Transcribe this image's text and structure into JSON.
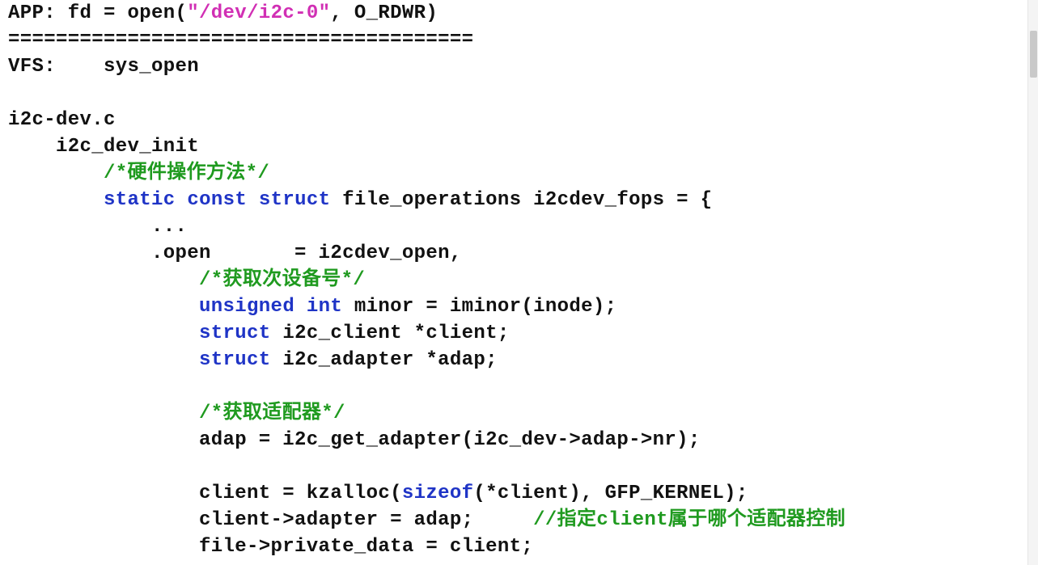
{
  "colors": {
    "keyword": "#1f34c6",
    "string": "#d12fb4",
    "comment": "#1f9a1f",
    "text": "#111111",
    "background": "#ffffff"
  },
  "lines": [
    {
      "tokens": [
        {
          "text": "APP: fd = open(",
          "cls": ""
        },
        {
          "text": "\"/dev/i2c-0\"",
          "cls": "str"
        },
        {
          "text": ", O_RDWR)",
          "cls": ""
        }
      ]
    },
    {
      "tokens": [
        {
          "text": "=======================================",
          "cls": ""
        }
      ]
    },
    {
      "tokens": [
        {
          "text": "VFS:    sys_open",
          "cls": ""
        }
      ]
    },
    {
      "tokens": []
    },
    {
      "tokens": [
        {
          "text": "i2c-dev.c",
          "cls": ""
        }
      ]
    },
    {
      "tokens": [
        {
          "text": "    i2c_dev_init",
          "cls": ""
        }
      ]
    },
    {
      "tokens": [
        {
          "text": "        ",
          "cls": ""
        },
        {
          "text": "/*硬件操作方法*/",
          "cls": "cm"
        }
      ]
    },
    {
      "tokens": [
        {
          "text": "        ",
          "cls": ""
        },
        {
          "text": "static",
          "cls": "kw"
        },
        {
          "text": " ",
          "cls": ""
        },
        {
          "text": "const",
          "cls": "kw"
        },
        {
          "text": " ",
          "cls": ""
        },
        {
          "text": "struct",
          "cls": "kw"
        },
        {
          "text": " file_operations i2cdev_fops = {",
          "cls": ""
        }
      ]
    },
    {
      "tokens": [
        {
          "text": "            ...",
          "cls": ""
        }
      ]
    },
    {
      "tokens": [
        {
          "text": "            .open       = i2cdev_open,",
          "cls": ""
        }
      ]
    },
    {
      "tokens": [
        {
          "text": "                ",
          "cls": ""
        },
        {
          "text": "/*获取次设备号*/",
          "cls": "cm"
        }
      ]
    },
    {
      "tokens": [
        {
          "text": "                ",
          "cls": ""
        },
        {
          "text": "unsigned",
          "cls": "kw"
        },
        {
          "text": " ",
          "cls": ""
        },
        {
          "text": "int",
          "cls": "kw"
        },
        {
          "text": " minor = iminor(inode);",
          "cls": ""
        }
      ]
    },
    {
      "tokens": [
        {
          "text": "                ",
          "cls": ""
        },
        {
          "text": "struct",
          "cls": "kw"
        },
        {
          "text": " i2c_client *client;",
          "cls": ""
        }
      ]
    },
    {
      "tokens": [
        {
          "text": "                ",
          "cls": ""
        },
        {
          "text": "struct",
          "cls": "kw"
        },
        {
          "text": " i2c_adapter *adap;",
          "cls": ""
        }
      ]
    },
    {
      "tokens": []
    },
    {
      "tokens": [
        {
          "text": "                ",
          "cls": ""
        },
        {
          "text": "/*获取适配器*/",
          "cls": "cm"
        }
      ]
    },
    {
      "tokens": [
        {
          "text": "                adap = i2c_get_adapter(i2c_dev->adap->nr);",
          "cls": ""
        }
      ]
    },
    {
      "tokens": []
    },
    {
      "tokens": [
        {
          "text": "                client = kzalloc(",
          "cls": ""
        },
        {
          "text": "sizeof",
          "cls": "kw"
        },
        {
          "text": "(*client), GFP_KERNEL);",
          "cls": ""
        }
      ]
    },
    {
      "tokens": [
        {
          "text": "                client->adapter = adap;     ",
          "cls": ""
        },
        {
          "text": "//指定client属于哪个适配器控制",
          "cls": "cm"
        }
      ]
    },
    {
      "tokens": [
        {
          "text": "                file->private_data = client;",
          "cls": ""
        }
      ]
    }
  ]
}
